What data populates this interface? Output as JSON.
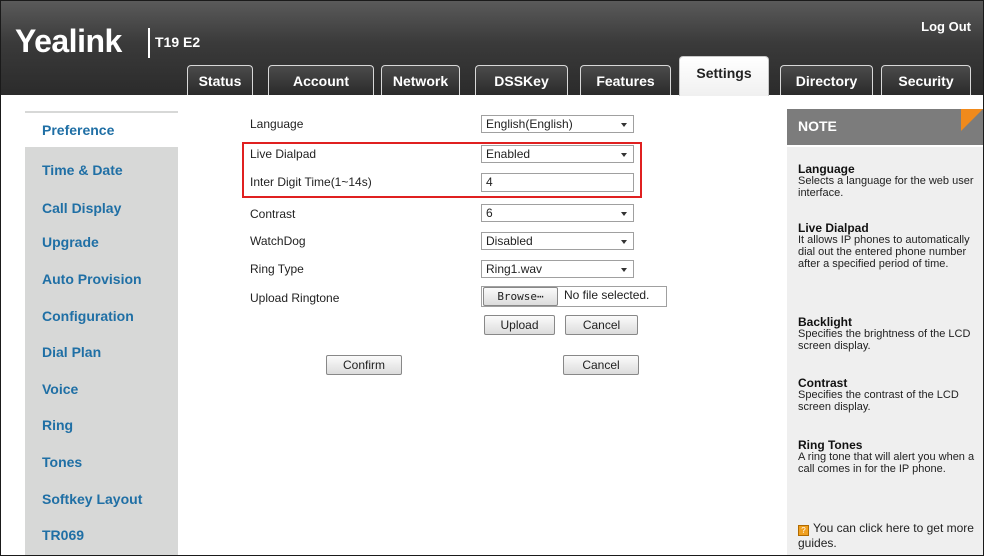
{
  "header": {
    "logo": "Yealink",
    "model": "T19 E2",
    "logout": "Log Out"
  },
  "tabs": [
    {
      "label": "Status"
    },
    {
      "label": "Account"
    },
    {
      "label": "Network"
    },
    {
      "label": "DSSKey"
    },
    {
      "label": "Features"
    },
    {
      "label": "Settings",
      "active": true
    },
    {
      "label": "Directory"
    },
    {
      "label": "Security"
    }
  ],
  "sidebar": {
    "items": [
      {
        "label": "Preference",
        "active": true
      },
      {
        "label": "Time & Date"
      },
      {
        "label": "Call Display"
      },
      {
        "label": "Upgrade"
      },
      {
        "label": "Auto Provision"
      },
      {
        "label": "Configuration"
      },
      {
        "label": "Dial Plan"
      },
      {
        "label": "Voice"
      },
      {
        "label": "Ring"
      },
      {
        "label": "Tones"
      },
      {
        "label": "Softkey Layout"
      },
      {
        "label": "TR069"
      }
    ]
  },
  "form": {
    "language": {
      "label": "Language",
      "value": "English(English)"
    },
    "live_dialpad": {
      "label": "Live Dialpad",
      "value": "Enabled"
    },
    "inter_digit": {
      "label": "Inter Digit Time(1~14s)",
      "value": "4"
    },
    "contrast": {
      "label": "Contrast",
      "value": "6"
    },
    "watchdog": {
      "label": "WatchDog",
      "value": "Disabled"
    },
    "ring_type": {
      "label": "Ring Type",
      "value": "Ring1.wav"
    },
    "upload_ringtone": {
      "label": "Upload Ringtone",
      "browse": "Browse⋯",
      "file_status": "No file selected.",
      "upload": "Upload",
      "cancel": "Cancel"
    },
    "confirm": "Confirm",
    "cancel": "Cancel"
  },
  "note": {
    "title": "NOTE",
    "sections": [
      {
        "title": "Language",
        "text": "Selects a language for the web user interface."
      },
      {
        "title": "Live Dialpad",
        "text": "It allows IP phones to automatically dial out the entered phone number after a specified period of time."
      },
      {
        "title": "Backlight",
        "text": "Specifies the brightness of the LCD screen display."
      },
      {
        "title": "Contrast",
        "text": "Specifies the contrast of the LCD screen display."
      },
      {
        "title": "Ring Tones",
        "text": "A ring tone that will alert you when a call comes in for the IP phone."
      }
    ],
    "guide": "You can click here to get more guides."
  },
  "colors": {
    "sidebar_link": "#1f6fa5",
    "highlight": "#e02020",
    "note_corner": "#f08a1c"
  }
}
